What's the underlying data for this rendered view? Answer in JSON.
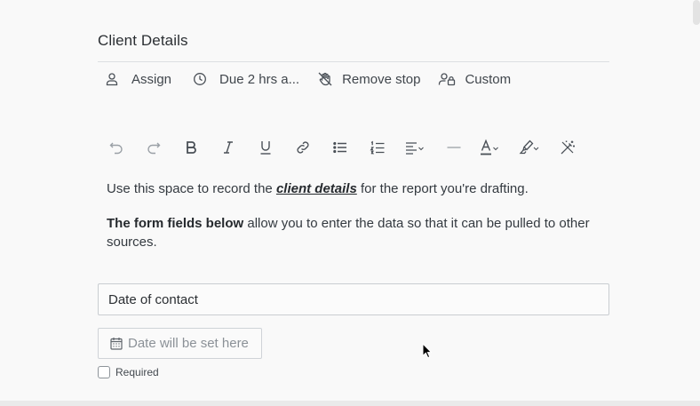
{
  "section": {
    "title": "Client Details"
  },
  "meta": {
    "assign": "Assign",
    "due": "Due 2 hrs a...",
    "remove_stop": "Remove stop",
    "custom": "Custom"
  },
  "toolbar": {
    "tools": [
      {
        "name": "undo",
        "icon": "undo-icon",
        "disabled": true
      },
      {
        "name": "redo",
        "icon": "redo-icon",
        "disabled": true
      },
      {
        "name": "bold",
        "icon": "bold-icon"
      },
      {
        "name": "italic",
        "icon": "italic-icon"
      },
      {
        "name": "underline",
        "icon": "underline-icon"
      },
      {
        "name": "link",
        "icon": "link-icon"
      },
      {
        "name": "bullet-list",
        "icon": "bullet-list-icon"
      },
      {
        "name": "numbered-list",
        "icon": "numbered-list-icon"
      },
      {
        "name": "align",
        "icon": "align-left-icon"
      },
      {
        "name": "horizontal-rule",
        "icon": "horizontal-rule-icon",
        "disabled": true
      },
      {
        "name": "text-color",
        "icon": "text-color-icon"
      },
      {
        "name": "highlight",
        "icon": "highlighter-icon"
      },
      {
        "name": "clear-format",
        "icon": "magic-wand-icon"
      }
    ]
  },
  "editor": {
    "p1_before": "Use this space to record the ",
    "p1_emph": "client details",
    "p1_after": " for the report you're drafting.",
    "p2_bold": "The form fields below",
    "p2_rest": " allow you to enter the data so that it can be pulled to other sources."
  },
  "field": {
    "label": "Date of contact",
    "date_placeholder": "Date will be set here",
    "required_label": "Required",
    "required_checked": false
  },
  "colors": {
    "text": "#2e3338",
    "border": "#c9cdd1",
    "background": "#f9f9f9"
  }
}
